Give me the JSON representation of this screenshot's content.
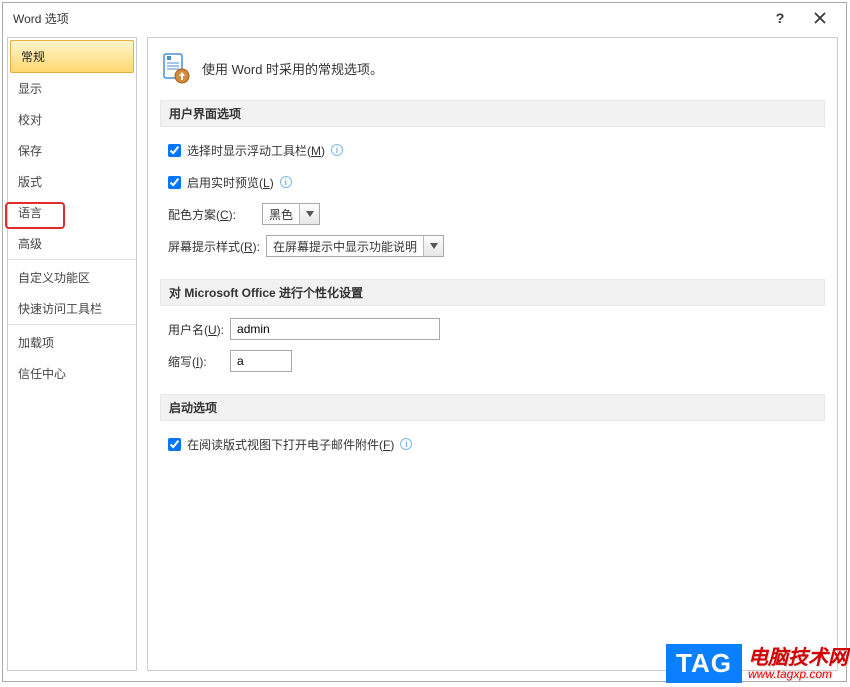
{
  "titlebar": {
    "title": "Word 选项",
    "help_label": "?",
    "close_label": "×"
  },
  "sidebar": {
    "items": [
      {
        "label": "常规",
        "selected": true
      },
      {
        "label": "显示"
      },
      {
        "label": "校对"
      },
      {
        "label": "保存"
      },
      {
        "label": "版式"
      },
      {
        "label": "语言"
      },
      {
        "label": "高级",
        "divider_after": true,
        "annotated": true
      },
      {
        "label": "自定义功能区"
      },
      {
        "label": "快速访问工具栏",
        "divider_after": true
      },
      {
        "label": "加载项"
      },
      {
        "label": "信任中心"
      }
    ]
  },
  "header": {
    "text": "使用 Word 时采用的常规选项。"
  },
  "sections": {
    "ui": {
      "title": "用户界面选项",
      "mini_toolbar": {
        "checked": true,
        "label_pre": "选择时显示浮动工具栏(",
        "hotkey": "M",
        "label_post": ")"
      },
      "live_preview": {
        "checked": true,
        "label_pre": "启用实时预览(",
        "hotkey": "L",
        "label_post": ")"
      },
      "color_scheme": {
        "label_pre": "配色方案(",
        "hotkey": "C",
        "label_post": "):",
        "value": "黑色"
      },
      "screentip": {
        "label_pre": "屏幕提示样式(",
        "hotkey": "R",
        "label_post": "):",
        "value": "在屏幕提示中显示功能说明"
      }
    },
    "personalize": {
      "title": "对 Microsoft Office 进行个性化设置",
      "username": {
        "label_pre": "用户名(",
        "hotkey": "U",
        "label_post": "):",
        "value": "admin"
      },
      "initials": {
        "label_pre": "缩写(",
        "hotkey": "I",
        "label_post": "):",
        "value": "a"
      }
    },
    "startup": {
      "title": "启动选项",
      "open_email": {
        "checked": true,
        "label_pre": "在阅读版式视图下打开电子邮件附件(",
        "hotkey": "F",
        "label_post": ")"
      }
    }
  },
  "watermark": {
    "tag": "TAG",
    "line1": "电脑技术网",
    "line2": "www.tagxp.com"
  }
}
